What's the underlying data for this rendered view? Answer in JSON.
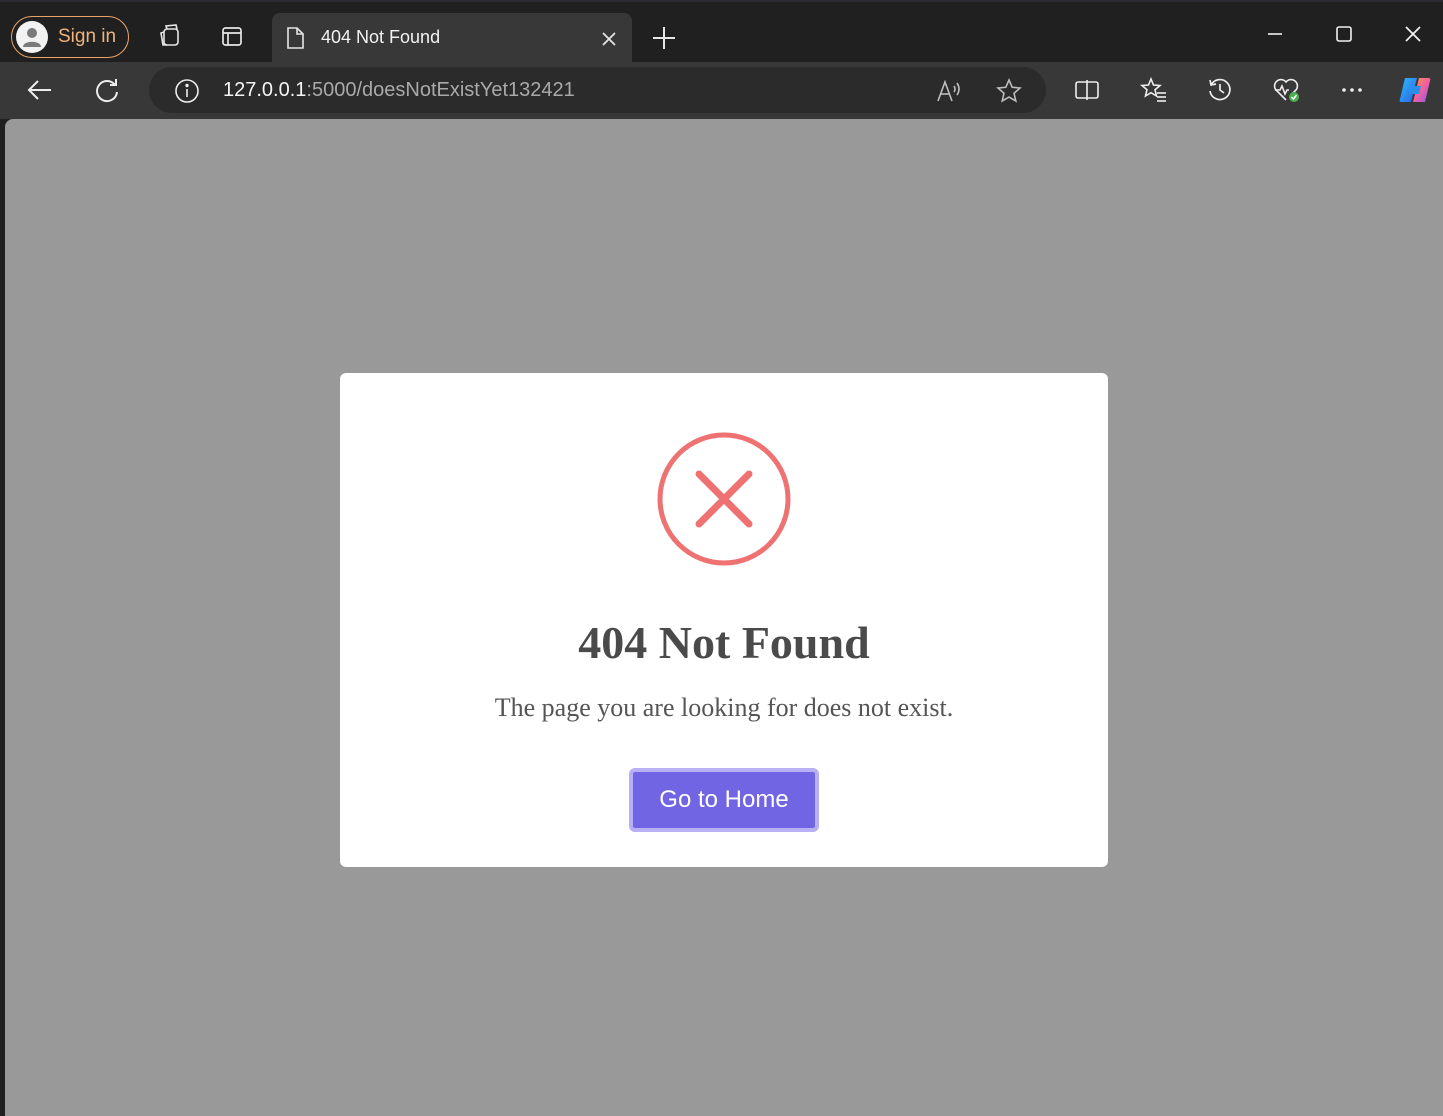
{
  "browser": {
    "signin_label": "Sign in",
    "tab": {
      "title": "404 Not Found"
    },
    "address_bar": {
      "host": "127.0.0.1",
      "rest": ":5000/doesNotExistYet132421"
    },
    "icons": {
      "profile": "profile-icon",
      "workspaces": "workspaces-icon",
      "tab_actions": "tab-actions-icon",
      "page": "page-icon",
      "close_tab": "close-icon",
      "new_tab": "plus-icon",
      "minimize": "minimize-icon",
      "maximize": "maximize-icon",
      "close_window": "close-window-icon",
      "back": "back-arrow-icon",
      "refresh": "refresh-icon",
      "site_info": "info-icon",
      "read_aloud": "read-aloud-icon",
      "favorite": "star-icon",
      "split_screen": "split-screen-icon",
      "favorites": "favorites-icon",
      "history": "history-icon",
      "performance": "browser-essentials-icon",
      "more": "more-icon",
      "copilot": "copilot-icon"
    }
  },
  "page": {
    "background": "#999999",
    "card": {
      "icon": "error-x-icon",
      "icon_color": "#ee7272",
      "title": "404 Not Found",
      "message": "The page you are looking for does not exist.",
      "button_label": "Go to Home",
      "button_color": "#7265e3"
    }
  }
}
